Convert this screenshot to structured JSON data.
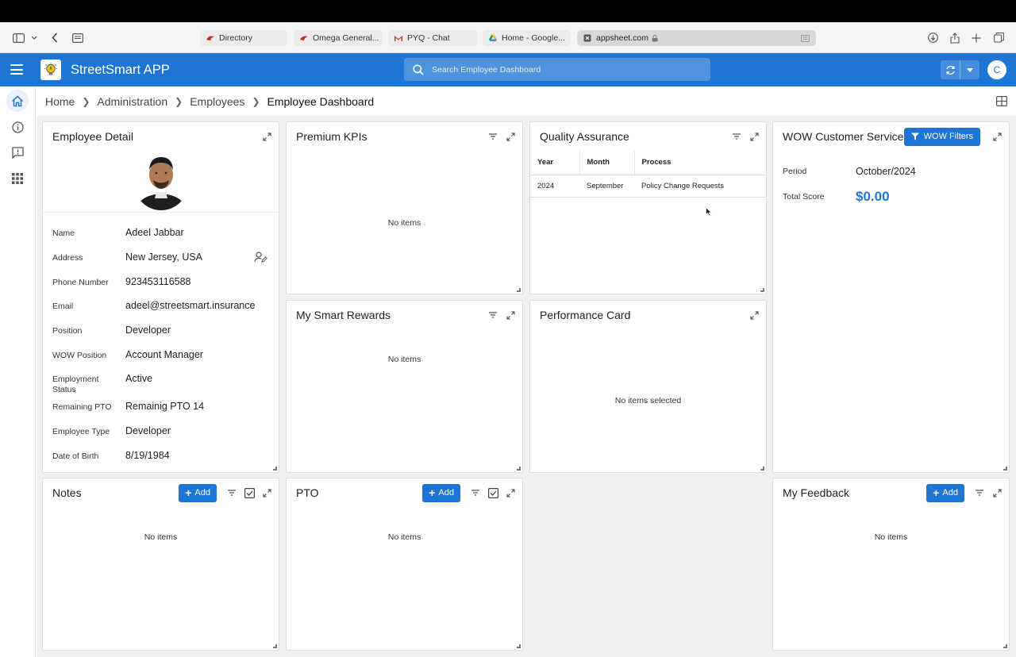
{
  "browser": {
    "tabs": [
      {
        "label": "Directory",
        "favicon": "red-wing-icon"
      },
      {
        "label": "Omega General...",
        "favicon": "red-wing-icon"
      },
      {
        "label": "PYQ - Chat",
        "favicon": "gmail-icon"
      },
      {
        "label": "Home - Google...",
        "favicon": "google-drive-icon"
      },
      {
        "label": "appsheet.com",
        "favicon": "appsheet-icon"
      }
    ]
  },
  "app": {
    "title": "StreetSmart APP",
    "search_placeholder": "Search Employee Dashboard",
    "avatar_initial": "C",
    "brand_color": "#1e75d3"
  },
  "breadcrumb": {
    "items": [
      "Home",
      "Administration",
      "Employees"
    ],
    "current": "Employee Dashboard"
  },
  "employee_detail": {
    "title": "Employee Detail",
    "fields": [
      {
        "label": "Name",
        "value": "Adeel Jabbar"
      },
      {
        "label": "Address",
        "value": "New Jersey, USA"
      },
      {
        "label": "Phone Number",
        "value": "923453116588"
      },
      {
        "label": "Email",
        "value": "adeel@streetsmart.insurance"
      },
      {
        "label": "Position",
        "value": "Developer"
      },
      {
        "label": "WOW Position",
        "value": "Account Manager"
      },
      {
        "label": "Employment Status",
        "value": "Active"
      },
      {
        "label": "Remaining PTO",
        "value": "Remainig PTO 14"
      },
      {
        "label": "Employee Type",
        "value": "Developer"
      },
      {
        "label": "Date of Birth",
        "value": "8/19/1984"
      }
    ]
  },
  "premium_kpis": {
    "title": "Premium KPIs",
    "empty": "No items"
  },
  "quality_assurance": {
    "title": "Quality Assurance",
    "columns": [
      "Year",
      "Month",
      "Process"
    ],
    "rows": [
      {
        "year": "2024",
        "month": "September",
        "process": "Policy Change Requests"
      }
    ]
  },
  "wow": {
    "title": "WOW Customer Service",
    "filter_label": "WOW Filters",
    "period_label": "Period",
    "period_value": "October/2024",
    "score_label": "Total Score",
    "score_value": "$0.00"
  },
  "smart_rewards": {
    "title": "My Smart Rewards",
    "empty": "No items"
  },
  "performance_card": {
    "title": "Performance Card",
    "empty": "No items selected"
  },
  "notes": {
    "title": "Notes",
    "add_label": "Add",
    "empty": "No items"
  },
  "pto": {
    "title": "PTO",
    "add_label": "Add",
    "empty": "No items"
  },
  "feedback": {
    "title": "My Feedback",
    "add_label": "Add",
    "empty": "No items"
  }
}
